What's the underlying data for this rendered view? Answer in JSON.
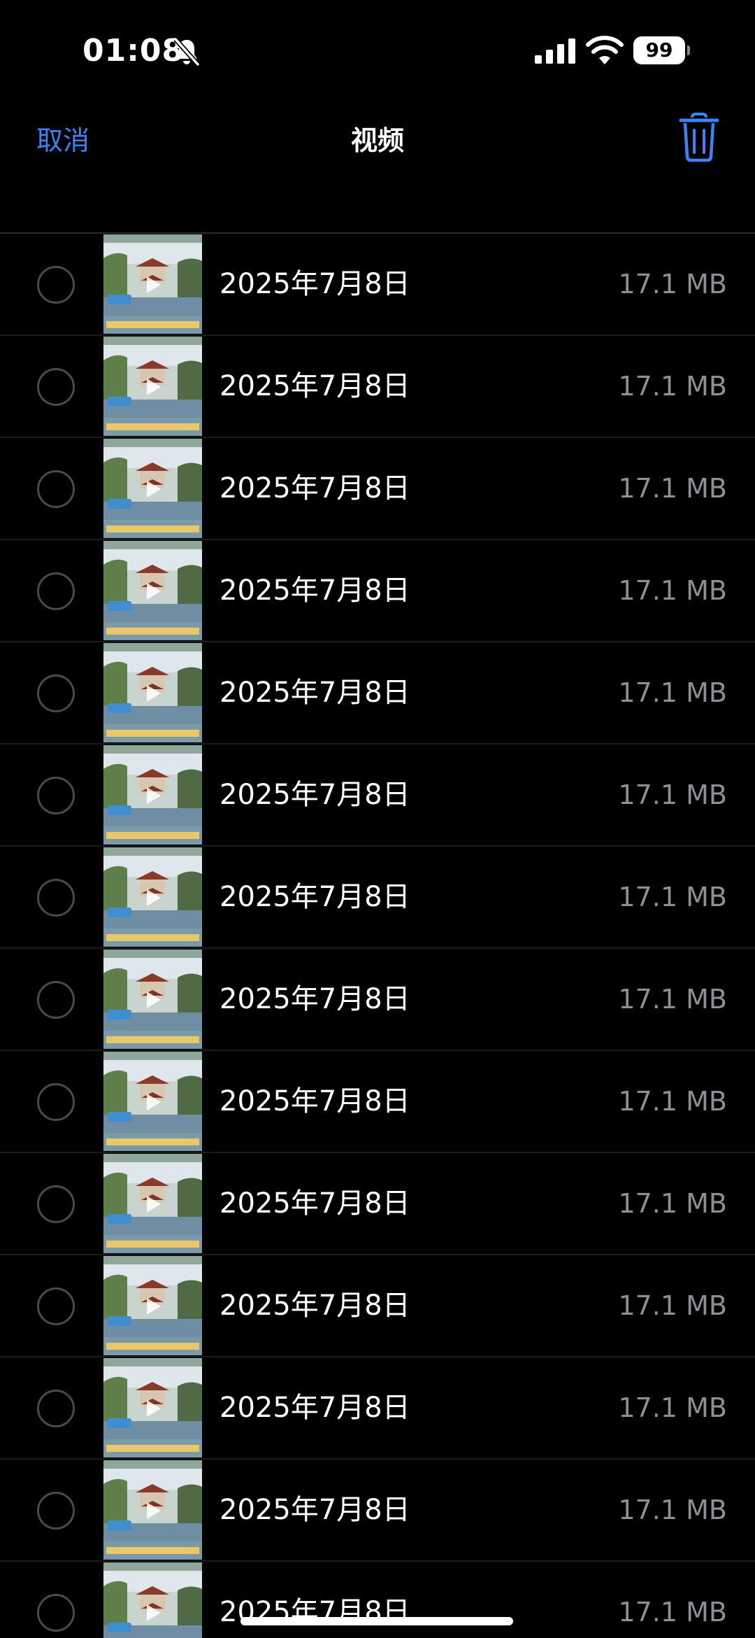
{
  "status_bar": {
    "time": "01:08",
    "battery": "99",
    "icons": [
      "bell-slash-icon",
      "cellular-signal-icon",
      "wifi-icon",
      "battery-icon"
    ]
  },
  "nav": {
    "cancel_label": "取消",
    "title": "视频",
    "delete_icon": "trash-icon"
  },
  "colors": {
    "background": "#000000",
    "accent": "#3b82f6",
    "secondary_text": "#8e8e93"
  },
  "videos": [
    {
      "date": "2025年7月8日",
      "size": "17.1 MB"
    },
    {
      "date": "2025年7月8日",
      "size": "17.1 MB"
    },
    {
      "date": "2025年7月8日",
      "size": "17.1 MB"
    },
    {
      "date": "2025年7月8日",
      "size": "17.1 MB"
    },
    {
      "date": "2025年7月8日",
      "size": "17.1 MB"
    },
    {
      "date": "2025年7月8日",
      "size": "17.1 MB"
    },
    {
      "date": "2025年7月8日",
      "size": "17.1 MB"
    },
    {
      "date": "2025年7月8日",
      "size": "17.1 MB"
    },
    {
      "date": "2025年7月8日",
      "size": "17.1 MB"
    },
    {
      "date": "2025年7月8日",
      "size": "17.1 MB"
    },
    {
      "date": "2025年7月8日",
      "size": "17.1 MB"
    },
    {
      "date": "2025年7月8日",
      "size": "17.1 MB"
    },
    {
      "date": "2025年7月8日",
      "size": "17.1 MB"
    },
    {
      "date": "2025年7月8日",
      "size": "17.1 MB"
    }
  ]
}
